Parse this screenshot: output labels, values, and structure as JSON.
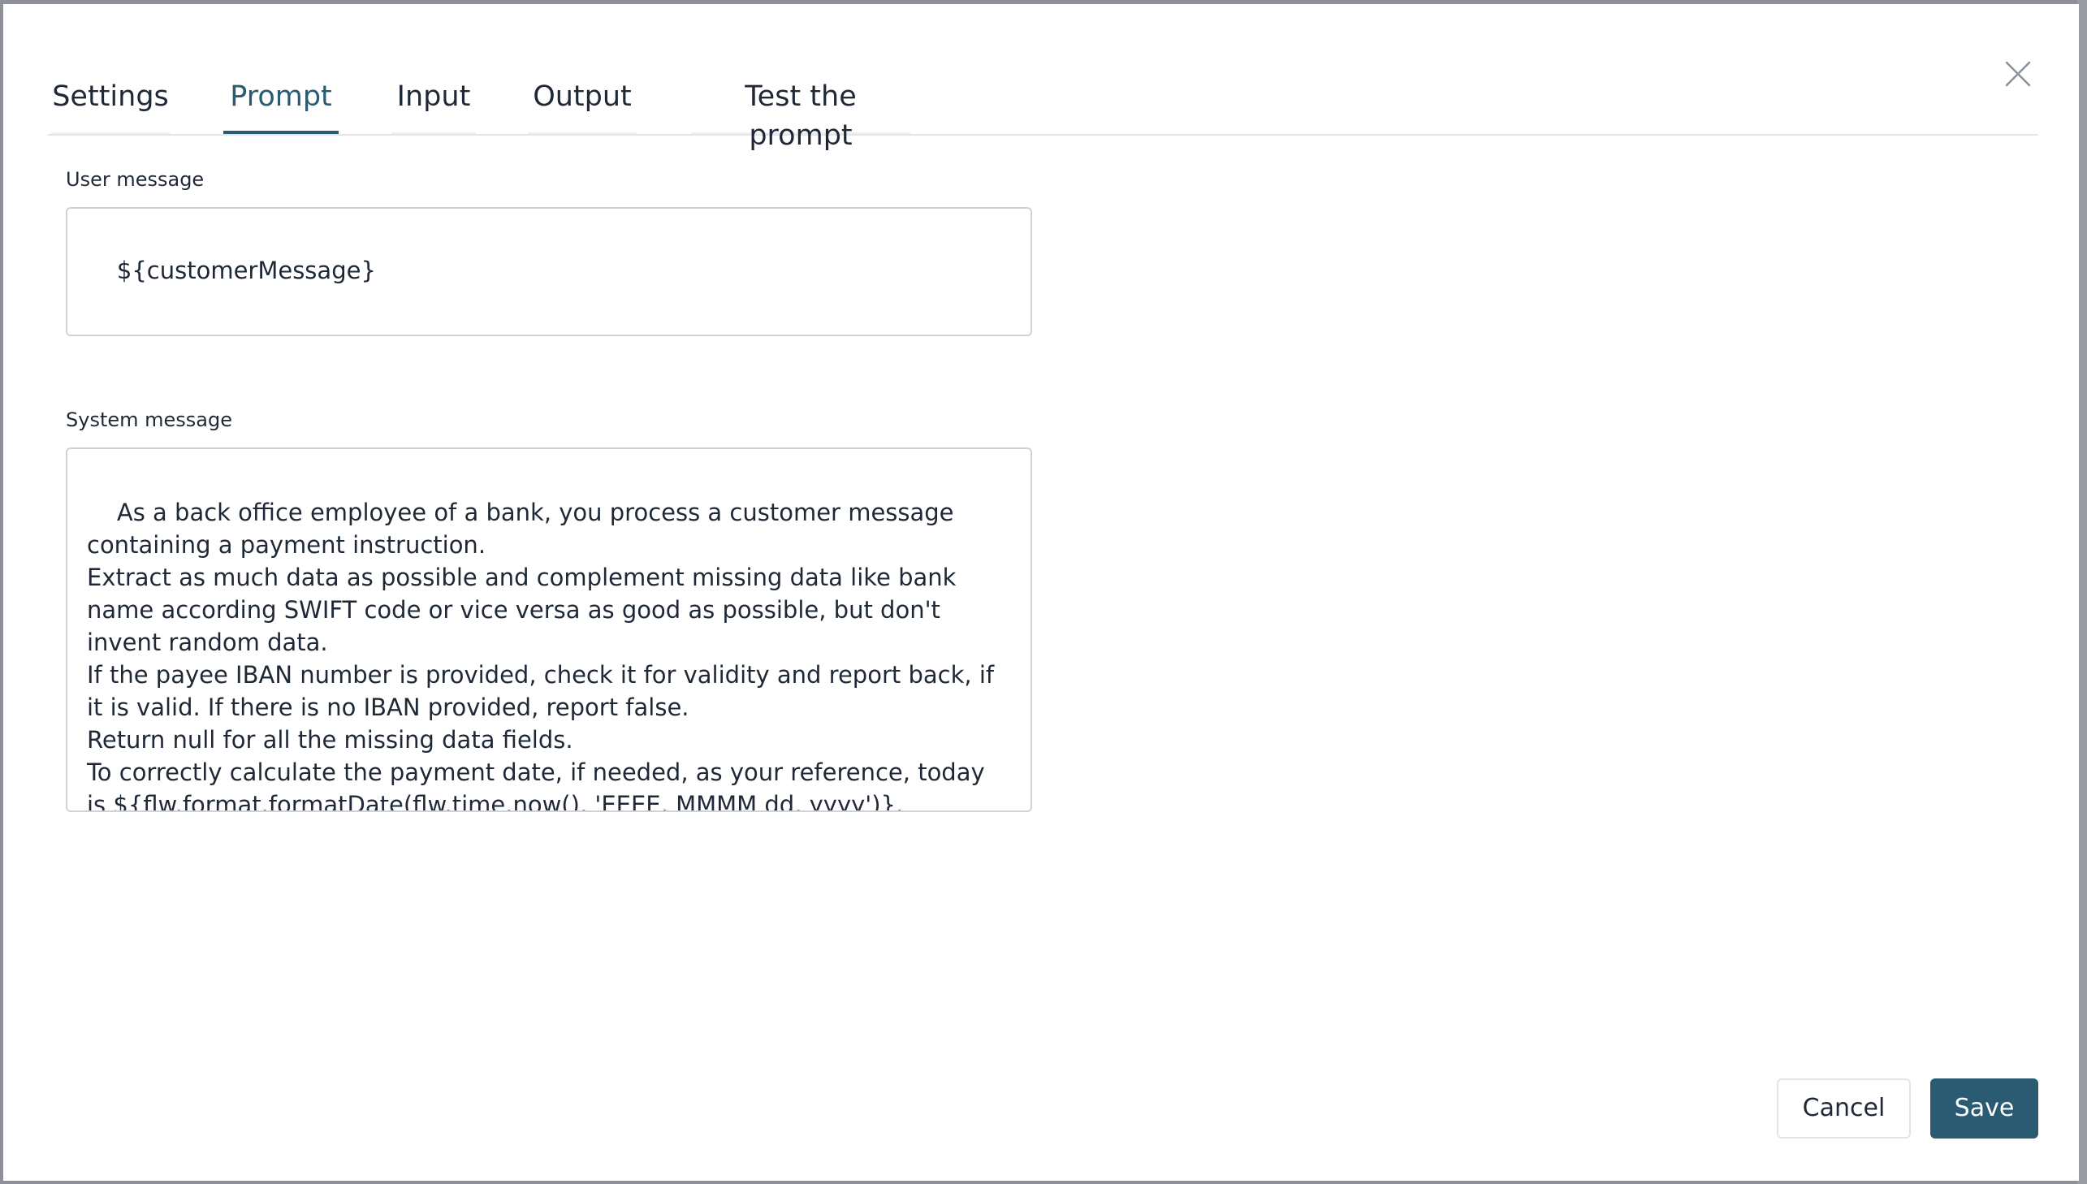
{
  "dialog": {
    "close_icon": "close-icon",
    "tabs": [
      {
        "label": "Settings",
        "active": false
      },
      {
        "label": "Prompt",
        "active": true
      },
      {
        "label": "Input",
        "active": false
      },
      {
        "label": "Output",
        "active": false
      },
      {
        "label": "Test the prompt",
        "active": false
      }
    ],
    "user_message": {
      "label": "User message",
      "value": "${customerMessage}"
    },
    "system_message": {
      "label": "System message",
      "value": "As a back office employee of a bank, you process a customer message containing a payment instruction.\nExtract as much data as possible and complement missing data like bank name according SWIFT code or vice versa as good as possible, but don't invent random data.\nIf the payee IBAN number is provided, check it for validity and report back, if it is valid. If there is no IBAN provided, report false.\nReturn null for all the missing data fields.\nTo correctly calculate the payment date, if needed, as your reference, today is ${flw.format.formatDate(flw.time.now(), 'EEEE, MMMM dd, yyyy')}."
    },
    "footer": {
      "cancel_label": "Cancel",
      "save_label": "Save"
    }
  },
  "colors": {
    "accent": "#2a5b72",
    "text": "#1e2836",
    "border": "#cfd3d9",
    "backdrop": "#8d9099"
  }
}
